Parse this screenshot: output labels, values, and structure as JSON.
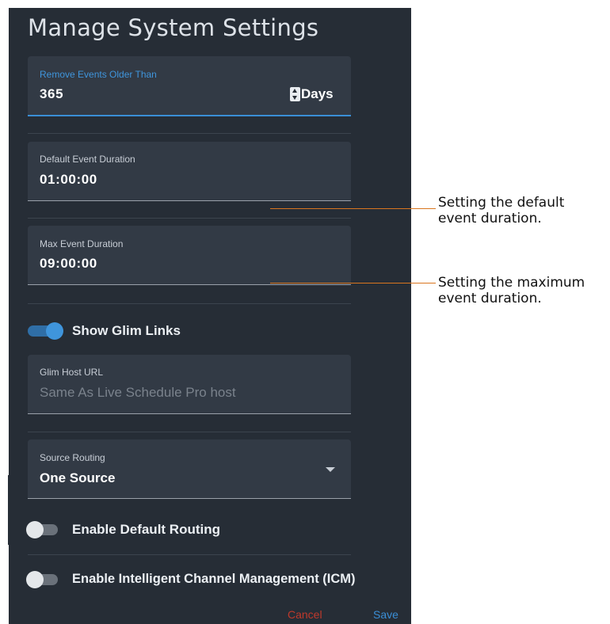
{
  "dialog": {
    "title": "Manage System Settings",
    "remove_events": {
      "label": "Remove Events Older Than",
      "value": "365",
      "unit": "Days"
    },
    "default_duration": {
      "label": "Default Event Duration",
      "value": "01:00:00"
    },
    "max_duration": {
      "label": "Max Event Duration",
      "value": "09:00:00"
    },
    "show_glim_links": {
      "label": "Show Glim Links",
      "on": true
    },
    "glim_host": {
      "label": "Glim Host URL",
      "placeholder": "Same As Live Schedule Pro host"
    },
    "source_routing": {
      "label": "Source Routing",
      "value": "One Source"
    },
    "default_routing": {
      "label": "Enable Default Routing",
      "on": false
    },
    "icm": {
      "label": "Enable Intelligent Channel Management (ICM)",
      "on": false
    },
    "cancel_label": "Cancel",
    "save_label": "Save"
  },
  "callouts": {
    "default_duration": [
      "Setting the default",
      "event duration."
    ],
    "max_duration": [
      "Setting the maximum",
      "event duration."
    ]
  },
  "colors": {
    "panel": "#262d36",
    "field": "#323a45",
    "accent": "#3a8ed6",
    "cancel": "#c0392b",
    "callout_line": "#d9761f"
  }
}
